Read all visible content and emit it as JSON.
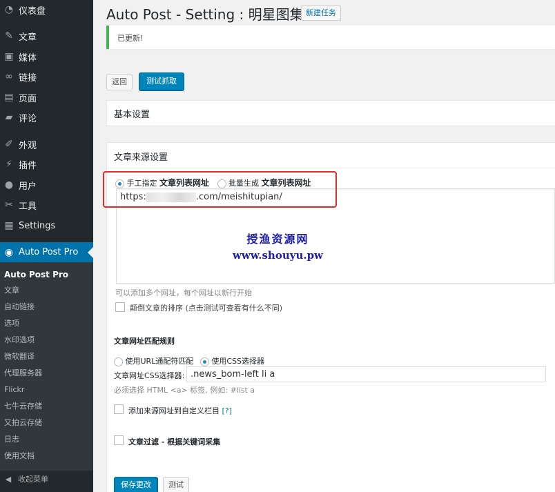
{
  "sidebar": {
    "items": [
      {
        "label": "仪表盘",
        "icon": "dashboard-icon"
      },
      {
        "label": "文章",
        "icon": "pin-icon"
      },
      {
        "label": "媒体",
        "icon": "media-icon"
      },
      {
        "label": "链接",
        "icon": "link-icon"
      },
      {
        "label": "页面",
        "icon": "page-icon"
      },
      {
        "label": "评论",
        "icon": "comment-icon"
      },
      {
        "label": "外观",
        "icon": "brush-icon"
      },
      {
        "label": "插件",
        "icon": "plugin-icon"
      },
      {
        "label": "用户",
        "icon": "user-icon"
      },
      {
        "label": "工具",
        "icon": "wrench-icon"
      },
      {
        "label": "Settings",
        "icon": "settings-icon"
      }
    ],
    "active": {
      "label": "Auto Post Pro",
      "icon": "autopost-icon"
    },
    "submenu": [
      "Auto Post Pro",
      "文章",
      "自动链接",
      "选项",
      "水印选项",
      "微软翻译",
      "代理服务器",
      "Flickr",
      "七牛云存储",
      "又拍云存储",
      "日志",
      "使用文档"
    ],
    "collapse": "收起菜单"
  },
  "header": {
    "title": "Auto Post - Setting : 明星图集",
    "new_task": "新建任务"
  },
  "notice": "已更新!",
  "buttons": {
    "back": "返回",
    "test_fetch": "测试抓取",
    "save": "保存更改",
    "test": "测试"
  },
  "basic_settings": {
    "title": "基本设置"
  },
  "source": {
    "title": "文章来源设置",
    "radio_manual_prefix": "手工指定",
    "radio_manual_bold": "文章列表网址",
    "radio_batch_prefix": "批量生成",
    "radio_batch_bold": "文章列表网址",
    "url_start": "https:",
    "url_end": ".com/meishitupian/",
    "hint": "可以添加多个网址，每个网址以新行开始",
    "reverse_label": "颠倒文章的排序 (点击测试可查看有什么不同)"
  },
  "watermark": {
    "line1": "授渔资源网",
    "line2": "www.shouyu.pw"
  },
  "match": {
    "title": "文章网址匹配规则",
    "radio_url": "使用URL通配符匹配",
    "radio_css": "使用CSS选择器",
    "selector_label": "文章网址CSS选择器:",
    "selector_value": ".news_bom-left li a",
    "selector_hint": "必须选择 HTML <a> 标签, 例如: #list a"
  },
  "custom_field": {
    "label": "添加来源网址到自定义栏目",
    "help": "[?]"
  },
  "filter": {
    "label": "文章过滤 - 根据关键词采集"
  }
}
